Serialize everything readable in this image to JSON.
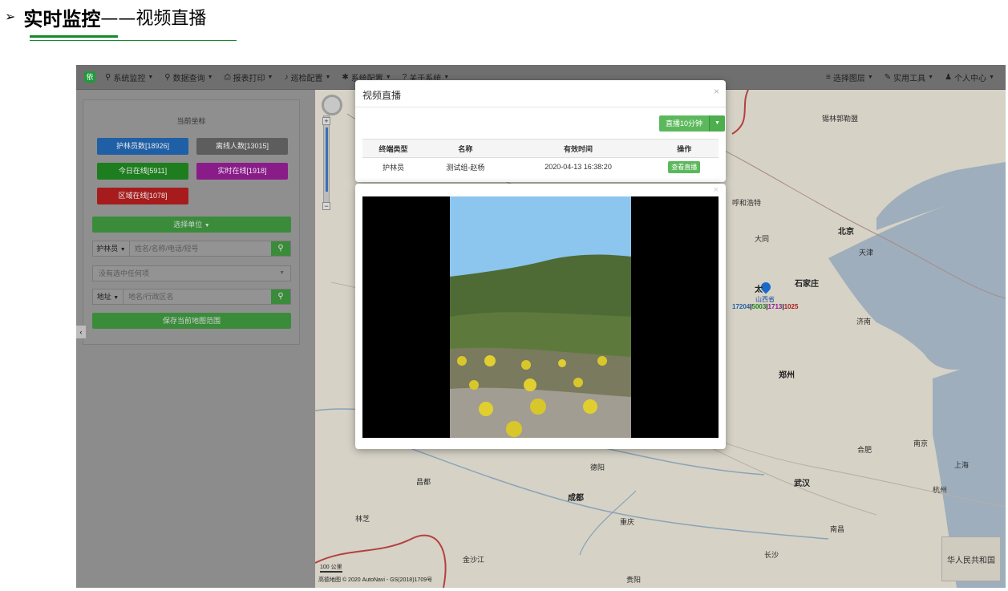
{
  "slide": {
    "title_bold": "实时监控",
    "title_rest": "——视频直播",
    "bullet": "➢"
  },
  "navbar": {
    "logo": "依",
    "items": [
      {
        "icon": "map-marker-icon",
        "glyph": "⚲",
        "label": "系统监控"
      },
      {
        "icon": "search-icon",
        "glyph": "⚲",
        "label": "数据查询"
      },
      {
        "icon": "print-icon",
        "glyph": "⎙",
        "label": "报表打印"
      },
      {
        "icon": "bell-icon",
        "glyph": "♪",
        "label": "巡检配置"
      },
      {
        "icon": "gear-icon",
        "glyph": "✱",
        "label": "系统配置"
      },
      {
        "icon": "question-icon",
        "glyph": "?",
        "label": "关于系统"
      }
    ],
    "right_items": [
      {
        "icon": "list-icon",
        "glyph": "≡",
        "label": "选择图层"
      },
      {
        "icon": "wrench-icon",
        "glyph": "✎",
        "label": "实用工具"
      },
      {
        "icon": "user-icon",
        "glyph": "♟",
        "label": "个人中心"
      }
    ]
  },
  "panel": {
    "title": "当前坐标",
    "stats": [
      {
        "label": "护林员数[18926]",
        "color": "#1f5fa6"
      },
      {
        "label": "离线人数[13015]",
        "color": "#5d5d5d"
      },
      {
        "label": "今日在线[5911]",
        "color": "#1e7d1e"
      },
      {
        "label": "实时在线[1918]",
        "color": "#8a1c8a"
      },
      {
        "label": "区域在线[1078]",
        "color": "#a61c1c"
      }
    ],
    "select_unit": "选择单位",
    "search1": {
      "addon": "护林员",
      "placeholder": "姓名/名称/电话/短号"
    },
    "dropdown": "没有选中任何项",
    "search2": {
      "addon": "地址",
      "placeholder": "地名/行政区名"
    },
    "save_range": "保存当前地图范围",
    "collapse": "‹"
  },
  "modal": {
    "title": "视频直播",
    "close": "×",
    "live_button": "直播10分钟",
    "columns": [
      "终端类型",
      "名称",
      "有效时间",
      "操作"
    ],
    "rows": [
      {
        "type": "护林员",
        "name": "测试组-赵杨",
        "time": "2020-04-13 16:38:20",
        "action": "查看直播"
      }
    ]
  },
  "video": {
    "close": "×"
  },
  "map": {
    "scale": "100 公里",
    "copyright": "高德地图 © 2020 AutoNavi - GS(2018)1709号",
    "overview_label": "华人民共和国",
    "marker_label": "山西省",
    "marker_city": "太",
    "counts": [
      {
        "value": "17204",
        "color": "#1f5fa6"
      },
      {
        "value": "5003",
        "color": "#1e7d1e"
      },
      {
        "value": "1713",
        "color": "#8a1c8a"
      },
      {
        "value": "1025",
        "color": "#a61c1c"
      }
    ],
    "cities": [
      {
        "name": "呼和浩特",
        "big": false
      },
      {
        "name": "北京",
        "big": true
      },
      {
        "name": "天津",
        "big": false
      },
      {
        "name": "石家庄",
        "big": true
      },
      {
        "name": "济南",
        "big": false
      },
      {
        "name": "郑州",
        "big": true
      },
      {
        "name": "合肥",
        "big": false
      },
      {
        "name": "南京",
        "big": false
      },
      {
        "name": "上海",
        "big": false
      },
      {
        "name": "武汉",
        "big": true
      },
      {
        "name": "杭州",
        "big": false
      },
      {
        "name": "成都",
        "big": true
      },
      {
        "name": "重庆",
        "big": false
      },
      {
        "name": "长沙",
        "big": false
      },
      {
        "name": "南昌",
        "big": false
      },
      {
        "name": "贵阳",
        "big": false
      },
      {
        "name": "林芝",
        "big": false
      },
      {
        "name": "昌都",
        "big": false
      },
      {
        "name": "德阳",
        "big": false
      },
      {
        "name": "锡林郭勒盟",
        "big": false
      },
      {
        "name": "大同",
        "big": false
      },
      {
        "name": "金沙江",
        "big": false
      }
    ]
  }
}
